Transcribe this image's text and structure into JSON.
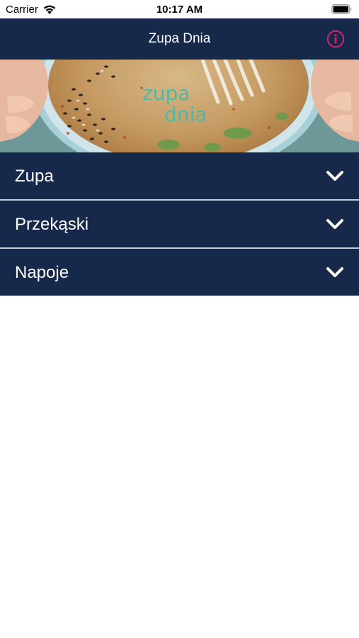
{
  "status_bar": {
    "carrier": "Carrier",
    "time": "10:17 AM",
    "icons": [
      "wifi-icon",
      "battery-icon"
    ]
  },
  "navbar": {
    "title": "Zupa Dnia",
    "info_icon": "info-icon",
    "info_color": "#d6246e"
  },
  "hero": {
    "logo_line1": "zupa",
    "logo_line2": "dnia",
    "logo_color": "#4fb9a6"
  },
  "sections": [
    {
      "label": "Zupa",
      "icon": "chevron-down-icon"
    },
    {
      "label": "Przekąski",
      "icon": "chevron-down-icon"
    },
    {
      "label": "Napoje",
      "icon": "chevron-down-icon"
    }
  ],
  "colors": {
    "primary": "#16294a",
    "background": "#ffffff"
  }
}
